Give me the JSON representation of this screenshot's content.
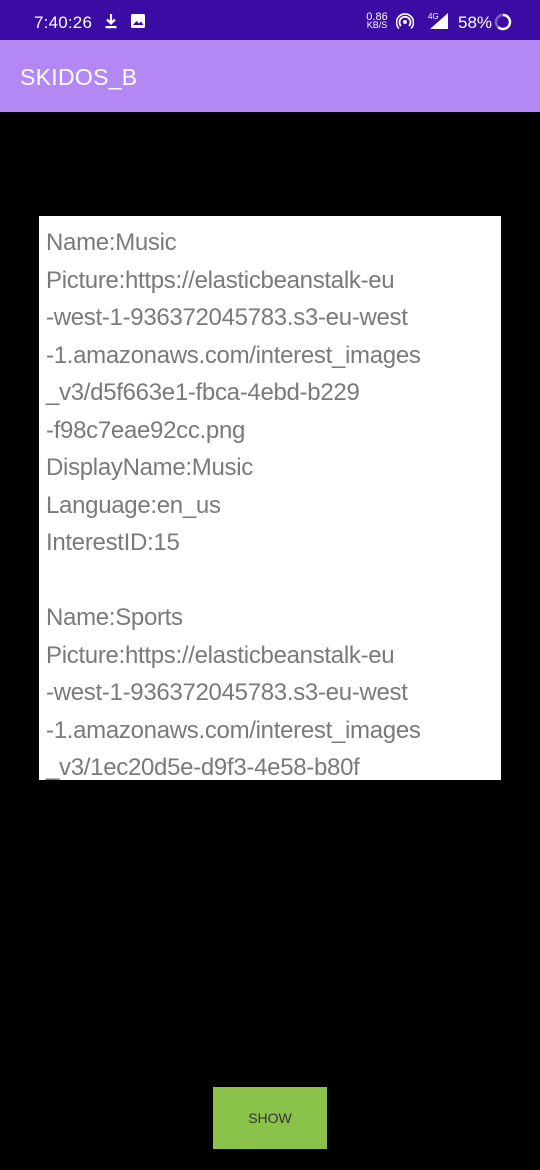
{
  "status_bar": {
    "time": "7:40:26",
    "speed_value": "0.86",
    "speed_unit": "KB/S",
    "network": "4G",
    "battery": "58%",
    "icons": [
      "download-icon",
      "image-icon",
      "hotspot-icon",
      "signal-icon",
      "battery-icon"
    ]
  },
  "app_bar": {
    "title": "SKIDOS_B"
  },
  "content": {
    "text": "Name:Music\nPicture:https://elasticbeanstalk-eu\n-west-1-936372045783.s3-eu-west\n-1.amazonaws.com/interest_images\n_v3/d5f663e1-fbca-4ebd-b229\n-f98c7eae92cc.png\nDisplayName:Music\nLanguage:en_us\nInterestID:15\n\nName:Sports\nPicture:https://elasticbeanstalk-eu\n-west-1-936372045783.s3-eu-west\n-1.amazonaws.com/interest_images\n_v3/1ec20d5e-d9f3-4e58-b80f"
  },
  "actions": {
    "show_label": "SHOW"
  },
  "colors": {
    "status_bar": "#3a0ca3",
    "app_bar": "#b388f5",
    "background": "#000000",
    "button": "#8bc34a",
    "text": "#7a7a7a"
  }
}
